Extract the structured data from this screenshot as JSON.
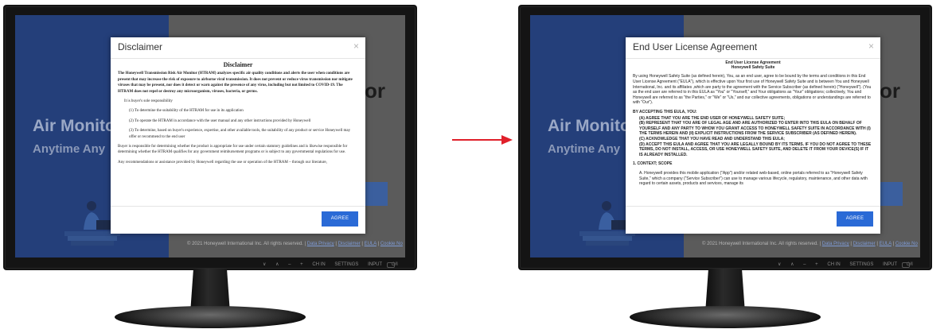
{
  "colors": {
    "accent": "#2a6ad6",
    "arrow": "#e0202a",
    "screen_left": "#243f7a"
  },
  "background_app": {
    "hero_line1": "Air Monito",
    "hero_line2": "Anytime Any",
    "heading_fragment": "or",
    "footer_copyright": "© 2021 Honeywell International Inc. All rights reserved.  |",
    "footer_links": [
      "Data Privacy",
      "Disclaimer",
      "EULA",
      "Cookie No"
    ]
  },
  "controls": {
    "labels": [
      "∨",
      "∧",
      "–",
      "+",
      "CH IN",
      "SETTINGS",
      "INPUT",
      "⏻/I"
    ]
  },
  "left_dialog": {
    "title": "Disclaimer",
    "close_icon": "×",
    "heading": "Disclaimer",
    "paragraphs": [
      "The Honeywell Transmission Risk Air Monitor (HTRAM) analyzes specific air quality conditions and alerts the user when conditions are present that may increase the risk of exposure to airborne viral transmission. It does not prevent or reduce virus transmission nor mitigate viruses that may be present, nor does it detect or warn against the presence of any virus, including but not limited to COVID-19. The HTRAM does not repel or destroy any microorganism, viruses, bacteria, or germs.",
      "It is buyer's sole responsibility",
      "(1) To determine the suitability of the HTRAM for use in its application",
      "(2) To operate the HTRAM in accordance with the user manual and any other instructions provided by Honeywell",
      "(3) To determine, based on buyer's experience, expertise, and other available tools, the suitability of any product or service Honeywell may offer or recommend to the end user",
      "Buyer is responsible for determining whether the product is appropriate for use under certain statutory guidelines and is likewise responsible for determining whether the HTRAM qualifies for any government reimbursement programs or is subject to any governmental regulations for use.",
      "Any recommendations or assistance provided by Honeywell regarding the use or operation of the HTRAM – through our literature,"
    ],
    "agree_label": "AGREE"
  },
  "right_dialog": {
    "title": "End User License Agreement",
    "close_icon": "×",
    "heading1": "End User License Agreement",
    "heading2": "Honeywell Safety Suite",
    "intro": "By using Honeywell Safety Suite (as defined herein), You, as an end user, agree to be bound by the terms and conditions in this End User License Agreement (\"EULA\"), which is effective upon Your first use of Honeywell Safety Suite and is between You and Honeywell International, Inc. and its affiliates ,which are party to the agreement with the Service Subscriber (as defined herein) (\"Honeywell\"). (You as the end user are referred to in this EULA as \"You\" or \"Yourself,\" and Your obligations as \"Your\" obligations; collectively, You and Honeywell are referred to as \"the Parties,\" or \"We\" or \"Us,\" and our collective agreements, obligations or understandings are referred to with \"Our\").",
    "accept_heading": "BY ACCEPTING THIS EULA, YOU:",
    "accept_items": [
      "(A)  AGREE THAT YOU ARE THE END USER OF HONEYWELL SAFETY SUITE;",
      "(B)  REPRESENT THAT YOU ARE OF LEGAL AGE AND ARE AUTHORIZED TO ENTER INTO THIS EULA ON BEHALF OF YOURSELF AND ANY PARTY TO WHOM YOU GRANT ACCESS TO HONEYWELL SAFETY SUITE IN ACCORDANCE WITH (I) THE TERMS HEREIN AND (II) EXPLICIT INSTRUCTIONS FROM THE SERVICE SUBSCRIBER (AS DEFINED HEREIN).",
      "(C)  ACKNOWLEDGE THAT YOU HAVE READ AND UNDERSTAND THIS EULA;",
      "(D)  ACCEPT THIS EULA AND AGREE THAT YOU ARE LEGALLY BOUND BY ITS TERMS. IF YOU DO NOT AGREE TO THESE TERMS, DO NOT INSTALL, ACCESS, OR USE HONEYWELL SAFETY SUITE, AND DELETE IT FROM YOUR DEVICE(S) IF IT IS ALREADY INSTALLED."
    ],
    "section1": "1.  CONTEXT; SCOPE",
    "section1_a": "A.   Honeywell provides this mobile application (\"App\") and/or related web-based, online portals  referred to as \"Honeywell Safety Suite,\" which a company (\"Service Subscriber\") can use to manage various lifecycle, regulatory, maintenance, and other data with regard to certain assets, products and services, manage its",
    "agree_label": "AGREE"
  }
}
